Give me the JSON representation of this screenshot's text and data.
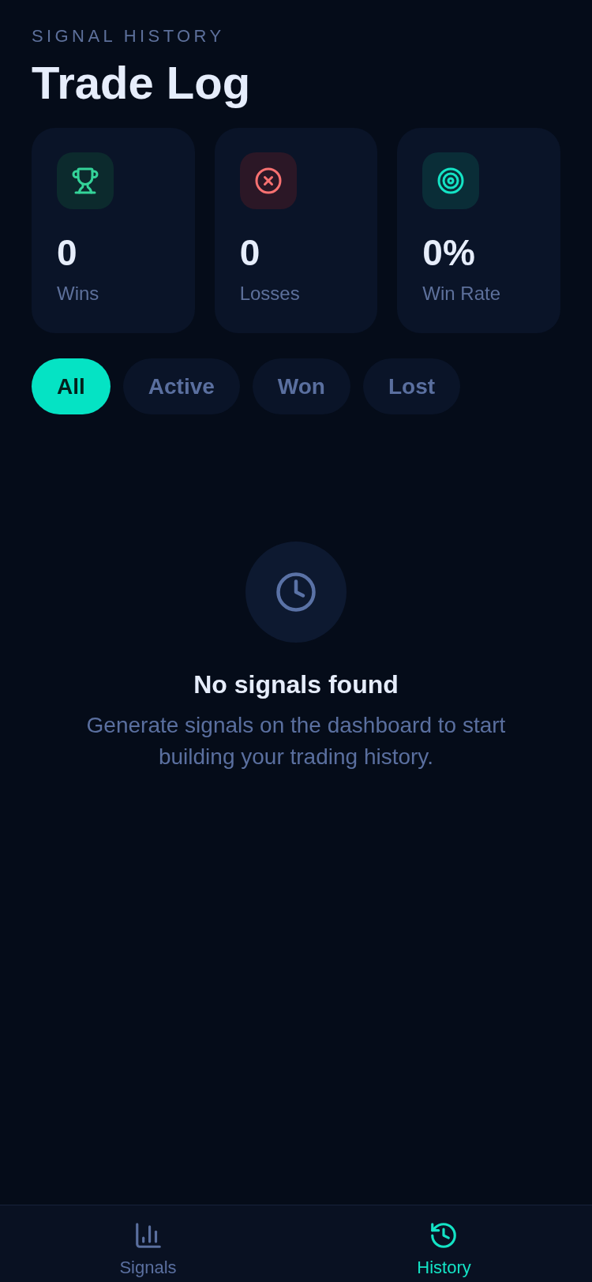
{
  "header": {
    "eyebrow": "SIGNAL HISTORY",
    "title": "Trade Log"
  },
  "stats": [
    {
      "kind": "wins",
      "value": "0",
      "label": "Wins"
    },
    {
      "kind": "losses",
      "value": "0",
      "label": "Losses"
    },
    {
      "kind": "win_rate",
      "value": "0%",
      "label": "Win Rate"
    }
  ],
  "filters": [
    {
      "label": "All",
      "selected": true
    },
    {
      "label": "Active",
      "selected": false
    },
    {
      "label": "Won",
      "selected": false
    },
    {
      "label": "Lost",
      "selected": false
    }
  ],
  "empty_state": {
    "title": "No signals found",
    "message": "Generate signals on the dashboard to start building your trading history."
  },
  "bottom_nav": [
    {
      "kind": "signals",
      "label": "Signals",
      "selected": false
    },
    {
      "kind": "history",
      "label": "History",
      "selected": true
    }
  ]
}
